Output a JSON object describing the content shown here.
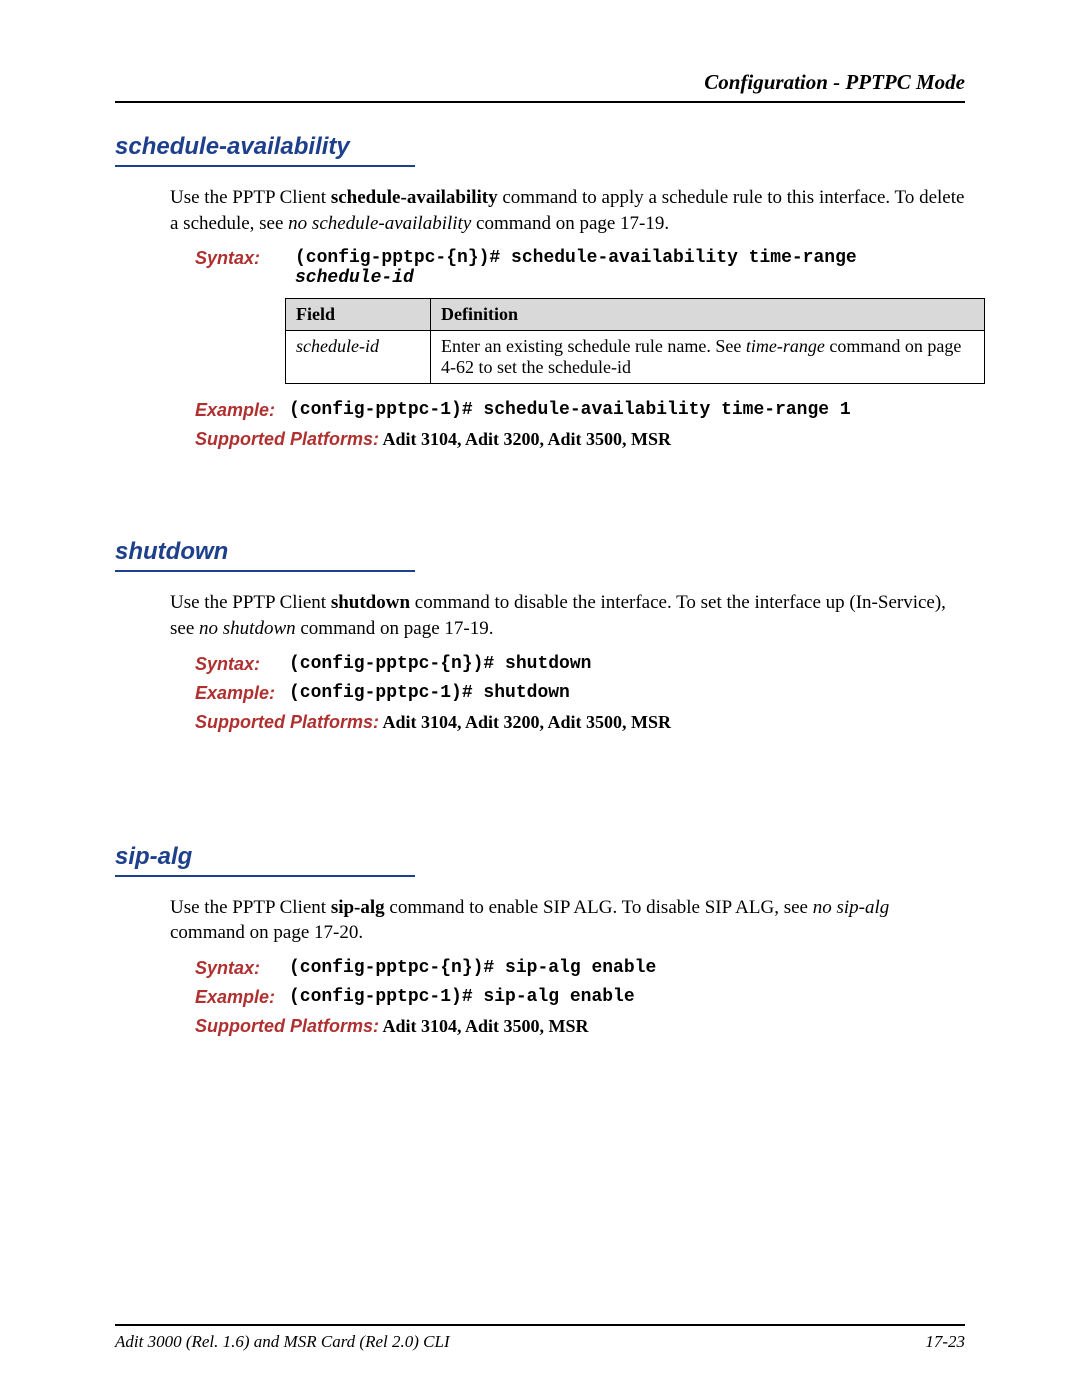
{
  "header": {
    "right": "Configuration - PPTPC Mode"
  },
  "sections": {
    "schedule": {
      "title": "schedule-availability",
      "intro_pre": "Use the PPTP Client ",
      "intro_bold1": "schedule-availability",
      "intro_mid": " command to apply a schedule rule to this interface. To delete a schedule, see ",
      "intro_italic": "no schedule-availability",
      "intro_post": " command on page 17-19.",
      "syntax_label": "Syntax:",
      "syntax_cmd": "(config-pptpc-{n})# schedule-availability time-range ",
      "syntax_arg": "schedule-id",
      "table": {
        "h1": "Field",
        "h2": "Definition",
        "r1c1": "schedule-id",
        "r1c2_pre": "Enter an existing schedule rule name. See ",
        "r1c2_italic": "time-range",
        "r1c2_post": " command on page 4-62 to set the schedule-id"
      },
      "example_label": "Example:",
      "example_cmd": "(config-pptpc-1)# schedule-availability time-range 1",
      "platforms_label": "Supported Platforms:",
      "platforms_value": "  Adit 3104, Adit 3200, Adit 3500, MSR"
    },
    "shutdown": {
      "title": "shutdown",
      "intro_pre": "Use the PPTP Client ",
      "intro_bold1": "shutdown",
      "intro_mid": " command to disable the interface. To set the interface up (In-Service), see ",
      "intro_italic": "no shutdown",
      "intro_post": " command on page 17-19.",
      "syntax_label": "Syntax:",
      "syntax_cmd": "(config-pptpc-{n})# shutdown",
      "example_label": "Example:",
      "example_cmd": "(config-pptpc-1)# shutdown",
      "platforms_label": "Supported Platforms:",
      "platforms_value": "  Adit 3104, Adit 3200, Adit 3500, MSR"
    },
    "sipalg": {
      "title": "sip-alg",
      "intro_pre": "Use the PPTP Client ",
      "intro_bold1": "sip-alg",
      "intro_mid": " command to enable SIP ALG. To disable SIP ALG, see ",
      "intro_italic": "no sip-alg",
      "intro_post": " command on page 17-20.",
      "syntax_label": "Syntax:",
      "syntax_cmd": "(config-pptpc-{n})# sip-alg enable",
      "example_label": "Example:",
      "example_cmd": "(config-pptpc-1)# sip-alg enable",
      "platforms_label": "Supported Platforms:",
      "platforms_value": "  Adit 3104, Adit 3500, MSR"
    }
  },
  "footer": {
    "left": "Adit 3000 (Rel. 1.6) and MSR Card (Rel 2.0) CLI",
    "right": "17-23"
  }
}
